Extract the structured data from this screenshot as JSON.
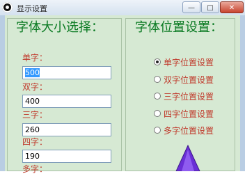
{
  "window": {
    "title": "显示设置",
    "buttons": {
      "minimize": "—",
      "maximize": "□",
      "close": "✕"
    }
  },
  "size_group": {
    "title": "字体大小选择：",
    "fields": [
      {
        "label": "单字：",
        "value": "500",
        "selected": true
      },
      {
        "label": "双字：",
        "value": "400",
        "selected": false
      },
      {
        "label": "三字：",
        "value": "260",
        "selected": false
      },
      {
        "label": "四字：",
        "value": "190",
        "selected": false
      },
      {
        "label": "多字：",
        "value": "",
        "selected": false
      }
    ]
  },
  "position_group": {
    "title": "字体位置设置：",
    "options": [
      {
        "label": "单字位置设置",
        "checked": true
      },
      {
        "label": "双字位置设置",
        "checked": false
      },
      {
        "label": "三字位置设置",
        "checked": false
      },
      {
        "label": "四字位置设置",
        "checked": false
      },
      {
        "label": "多字位置设置",
        "checked": false
      }
    ]
  },
  "icons": {
    "app": "soccer-ball-icon",
    "arrow": "purple-up-arrow-icon"
  },
  "colors": {
    "title_green": "#0a7a22",
    "label_red": "#c0392b",
    "panel_bg": "#d6e9d3",
    "arrow_purple": "#6a2fd6"
  }
}
